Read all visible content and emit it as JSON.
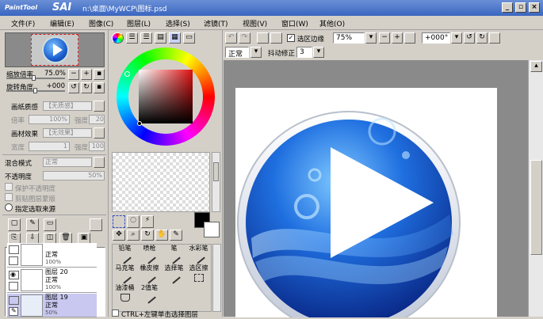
{
  "window": {
    "logo_small": "PaintTool",
    "logo_big": "SAI",
    "title": "n:\\桌面\\MyWCP\\图标.psd",
    "min_label": "_",
    "max_label": "▫",
    "close_label": "×"
  },
  "menu": [
    "文件(F)",
    "编辑(E)",
    "图像(C)",
    "图层(L)",
    "选择(S)",
    "滤镜(T)",
    "视图(V)",
    "窗口(W)",
    "其他(O)"
  ],
  "navigator": {
    "zoom_label": "缩放倍率",
    "zoom_value": "75.0%",
    "rotate_label": "旋转角度",
    "rotate_value": "+000",
    "minus": "−",
    "plus": "+"
  },
  "paper": {
    "texture_label": "画纸质感",
    "texture_value": "【无质感】",
    "scale_label": "倍率",
    "scale_value": "100%",
    "strength_label": "强度",
    "strength_value": "20",
    "effect_label": "画材效果",
    "effect_value": "【无效果】",
    "width_label": "宽度",
    "width_value": "1",
    "effect_strength_label": "强度",
    "effect_strength_value": "100"
  },
  "blend": {
    "mode_label": "混合模式",
    "mode_value": "正常",
    "opacity_label": "不透明度",
    "opacity_value": "50%",
    "protect_label": "保护不透明度",
    "clip_label": "剪贴图层蒙版",
    "source_label": "指定选取来源"
  },
  "layers": [
    {
      "name": "",
      "mode": "正常",
      "opacity": "100%",
      "state": "partial"
    },
    {
      "name": "图层 20",
      "mode": "正常",
      "opacity": "100%",
      "state": "normal"
    },
    {
      "name": "图层 19",
      "mode": "正常",
      "opacity": "50%",
      "state": "selected"
    }
  ],
  "tools": [
    {
      "label": "铅笔",
      "icon": "pencil-icon"
    },
    {
      "label": "喷枪",
      "icon": "airbrush-icon"
    },
    {
      "label": "笔",
      "icon": "pen-icon"
    },
    {
      "label": "水彩笔",
      "icon": "watercolor-icon"
    },
    {
      "label": "马克笔",
      "icon": "marker-icon"
    },
    {
      "label": "橡皮擦",
      "icon": "eraser-icon"
    },
    {
      "label": "选择笔",
      "icon": "select-pen-icon"
    },
    {
      "label": "选区擦",
      "icon": "select-eraser-icon"
    },
    {
      "label": "油漆桶",
      "icon": "bucket-icon"
    },
    {
      "label": "2值笔",
      "icon": "binary-pen-icon"
    }
  ],
  "tools_footer": "CTRL+左键单击选择图层",
  "toolbar": {
    "anti_alias_label": "选区边缘",
    "zoom_value": "75%",
    "rotate_value": "+000°",
    "mode_value": "正常",
    "stabilizer_label": "抖动修正",
    "stabilizer_value": "3"
  },
  "colors": {
    "primary": "#000000",
    "secondary": "#ffffff",
    "titlebar": "#3a66c0",
    "selected_layer": "#c8c8f0"
  }
}
